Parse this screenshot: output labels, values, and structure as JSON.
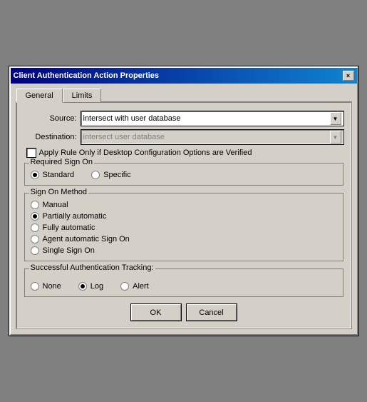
{
  "dialog": {
    "title": "Client Authentication Action Properties",
    "close_btn": "×"
  },
  "tabs": {
    "general_label": "General",
    "limits_label": "Limits"
  },
  "form": {
    "source_label": "Source:",
    "destination_label": "Destination:",
    "source_value": "intersect with user database",
    "destination_value": "intersect user database",
    "checkbox_label": "Apply Rule Only if Desktop Configuration Options are Verified"
  },
  "required_sign_on": {
    "title": "Required Sign On",
    "standard_label": "Standard",
    "specific_label": "Specific",
    "selected": "standard"
  },
  "sign_on_method": {
    "title": "Sign On Method",
    "options": [
      {
        "label": "Manual",
        "checked": false
      },
      {
        "label": "Partially automatic",
        "checked": true
      },
      {
        "label": "Fully automatic",
        "checked": false
      },
      {
        "label": "Agent automatic Sign On",
        "checked": false
      },
      {
        "label": "Single Sign On",
        "checked": false
      }
    ]
  },
  "auth_tracking": {
    "title": "Successful Authentication Tracking:",
    "options": [
      {
        "label": "None",
        "checked": false
      },
      {
        "label": "Log",
        "checked": true
      },
      {
        "label": "Alert",
        "checked": false
      }
    ]
  },
  "buttons": {
    "ok_label": "OK",
    "cancel_label": "Cancel"
  }
}
